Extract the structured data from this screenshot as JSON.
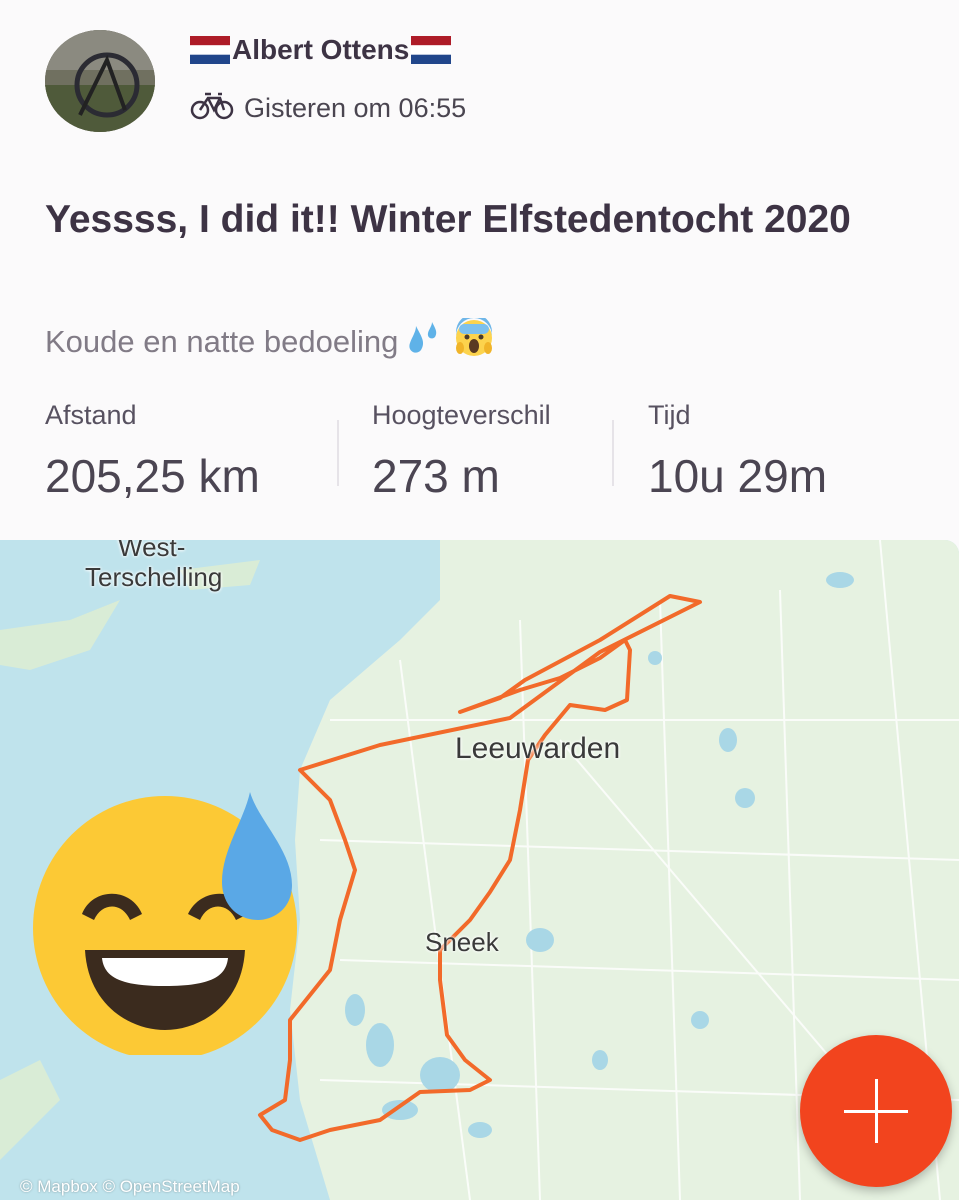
{
  "header": {
    "athlete_name": "Albert Ottens",
    "activity_icon": "bicycle-icon",
    "timestamp": "Gisteren om 06:55"
  },
  "activity": {
    "title": "Yessss, I did it!! Winter Elfstedentocht 2020",
    "description": "Koude en natte bedoeling",
    "description_emojis": [
      "sweat-droplets-icon",
      "screaming-face-icon"
    ]
  },
  "stats": [
    {
      "label": "Afstand",
      "value": "205,25 km"
    },
    {
      "label": "Hoogteverschil",
      "value": "273 m"
    },
    {
      "label": "Tijd",
      "value": "10u 29m"
    }
  ],
  "map": {
    "labels": {
      "west_terschelling_1": "West-",
      "west_terschelling_2": "Terschelling",
      "leeuwarden": "Leeuwarden",
      "sneek": "Sneek"
    },
    "attribution": "© Mapbox © OpenStreetMap",
    "route_color": "#f26a2a",
    "water_color": "#bfe3ec",
    "land_color": "#e6f2e1"
  },
  "fab": {
    "icon": "plus-icon"
  },
  "sticker": {
    "icon": "grinning-sweat-face-icon"
  }
}
